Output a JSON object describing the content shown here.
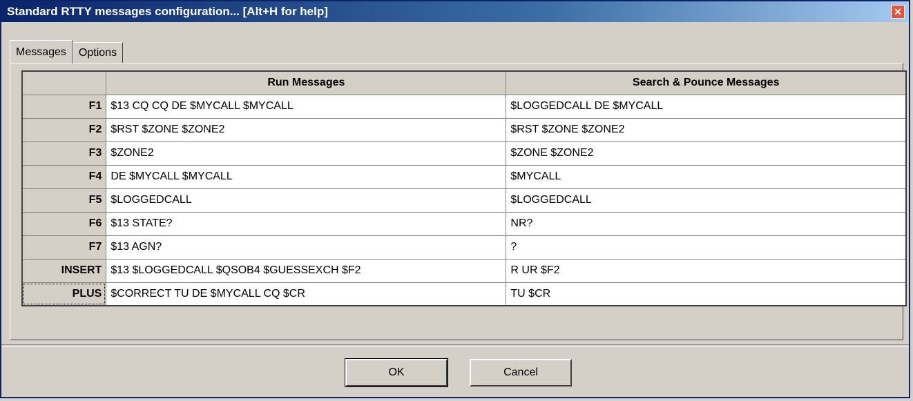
{
  "window": {
    "title": "Standard RTTY messages configuration... [Alt+H for help]",
    "close_glyph": "✕"
  },
  "tabs": [
    {
      "label": "Messages"
    },
    {
      "label": "Options"
    }
  ],
  "table": {
    "headers": {
      "run": "Run Messages",
      "sp": "Search & Pounce Messages"
    },
    "rows": [
      {
        "key": "F1",
        "run": "$13 CQ CQ DE $MYCALL $MYCALL",
        "sp": "$LOGGEDCALL DE $MYCALL"
      },
      {
        "key": "F2",
        "run": "$RST $ZONE $ZONE2",
        "sp": "$RST $ZONE $ZONE2"
      },
      {
        "key": "F3",
        "run": "$ZONE2",
        "sp": "$ZONE $ZONE2"
      },
      {
        "key": "F4",
        "run": "DE $MYCALL $MYCALL",
        "sp": "$MYCALL"
      },
      {
        "key": "F5",
        "run": "$LOGGEDCALL",
        "sp": "$LOGGEDCALL"
      },
      {
        "key": "F6",
        "run": "$13 STATE?",
        "sp": "NR?"
      },
      {
        "key": "F7",
        "run": "$13 AGN?",
        "sp": "?"
      },
      {
        "key": "INSERT",
        "run": "$13 $LOGGEDCALL $QSOB4 $GUESSEXCH $F2",
        "sp": "R UR $F2"
      },
      {
        "key": "PLUS",
        "run": "$CORRECT TU DE $MYCALL CQ $CR",
        "sp": "TU $CR"
      }
    ]
  },
  "buttons": {
    "ok": "OK",
    "cancel": "Cancel"
  },
  "colors": {
    "titlebar_start": "#0a246a",
    "titlebar_end": "#a6caf0",
    "dialog_bg": "#d4d0c8",
    "close_red": "#e8543b"
  }
}
